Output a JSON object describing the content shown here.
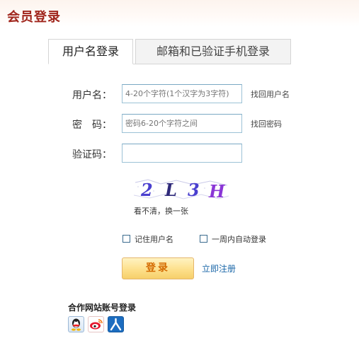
{
  "page": {
    "title": "会员登录"
  },
  "tabs": [
    {
      "label": "用户名登录",
      "active": true
    },
    {
      "label": "邮箱和已验证手机登录",
      "active": false
    }
  ],
  "form": {
    "username": {
      "label": "用户名：",
      "placeholder": "4-20个字符(1个汉字为3字符)",
      "value": "",
      "link": "找回用户名"
    },
    "password": {
      "label": "密　码：",
      "placeholder": "密码6-20个字符之间",
      "value": "",
      "link": "找回密码"
    },
    "captcha": {
      "label": "验证码：",
      "value": "",
      "chars": [
        "2",
        "L",
        "3",
        "H"
      ],
      "refresh_text": "看不清，换一张"
    }
  },
  "options": {
    "remember_username": {
      "label": "记住用户名",
      "checked": false
    },
    "auto_login_week": {
      "label": "一周内自动登录",
      "checked": false
    }
  },
  "actions": {
    "login_label": "登录",
    "register_label": "立即注册"
  },
  "partners": {
    "title": "合作网站账号登录",
    "icons": [
      {
        "name": "qq-icon",
        "color": "#2a7fcf"
      },
      {
        "name": "weibo-icon",
        "color": "#e6162d"
      },
      {
        "name": "renren-icon",
        "color": "#1c6dc0"
      }
    ]
  },
  "colors": {
    "title": "#a0251c",
    "accent_button": "#fde08c",
    "link": "#1b67a8"
  }
}
